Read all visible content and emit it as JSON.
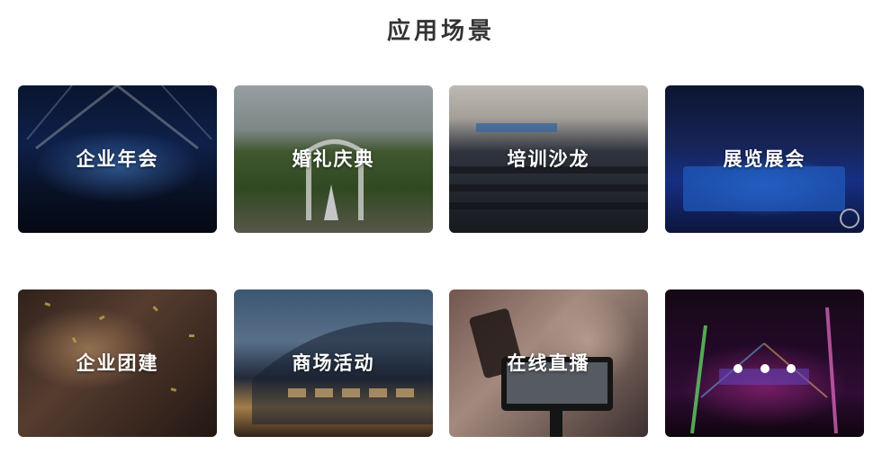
{
  "section": {
    "title": "应用场景"
  },
  "scenes": [
    {
      "label": "企业年会"
    },
    {
      "label": "婚礼庆典"
    },
    {
      "label": "培训沙龙"
    },
    {
      "label": "展览展会"
    },
    {
      "label": "企业团建"
    },
    {
      "label": "商场活动"
    },
    {
      "label": "在线直播"
    },
    {
      "label": ""
    }
  ],
  "carousel": {
    "dot_count": 3
  }
}
